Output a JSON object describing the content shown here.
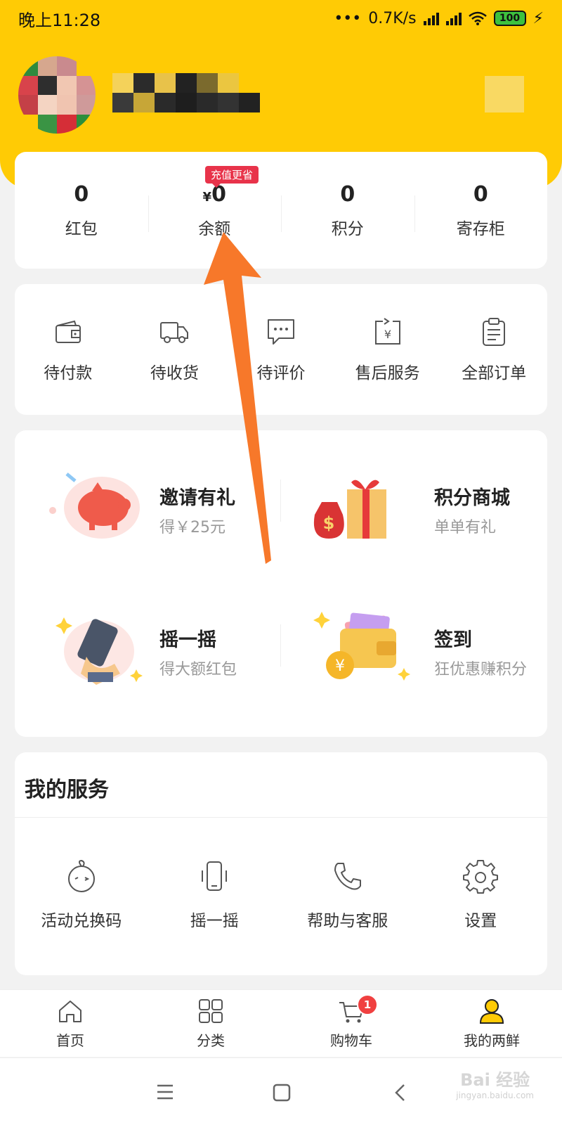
{
  "status_bar": {
    "time": "晚上11:28",
    "net_speed": "0.7K/s",
    "battery": "100"
  },
  "assets": [
    {
      "value": "0",
      "prefix": "",
      "label": "红包",
      "icon": "red-packet"
    },
    {
      "value": "0",
      "prefix": "¥",
      "label": "余额",
      "icon": "balance"
    },
    {
      "value": "0",
      "prefix": "",
      "label": "积分",
      "icon": "points"
    },
    {
      "value": "0",
      "prefix": "",
      "label": "寄存柜",
      "icon": "locker"
    }
  ],
  "balance_badge": "充值更省",
  "orders": [
    {
      "label": "待付款",
      "icon": "wallet-icon"
    },
    {
      "label": "待收货",
      "icon": "truck-icon"
    },
    {
      "label": "待评价",
      "icon": "chat-icon"
    },
    {
      "label": "售后服务",
      "icon": "refund-icon"
    },
    {
      "label": "全部订单",
      "icon": "clipboard-icon"
    }
  ],
  "promos": [
    {
      "title": "邀请有礼",
      "subtitle": "得￥25元",
      "icon": "piggy-bank-icon"
    },
    {
      "title": "积分商城",
      "subtitle": "单单有礼",
      "icon": "gift-box-icon"
    },
    {
      "title": "摇一摇",
      "subtitle": "得大额红包",
      "icon": "phone-shake-icon"
    },
    {
      "title": "签到",
      "subtitle": "狂优惠赚积分",
      "icon": "wallet-coin-icon"
    }
  ],
  "services": {
    "title": "我的服务",
    "items": [
      {
        "label": "活动兑换码",
        "icon": "baby-face-icon"
      },
      {
        "label": "摇一摇",
        "icon": "phone-vibrate-icon"
      },
      {
        "label": "帮助与客服",
        "icon": "phone-handset-icon"
      },
      {
        "label": "设置",
        "icon": "gear-icon"
      }
    ]
  },
  "tabbar": [
    {
      "label": "首页",
      "icon": "home-icon"
    },
    {
      "label": "分类",
      "icon": "grid-icon"
    },
    {
      "label": "购物车",
      "icon": "cart-icon",
      "badge": "1"
    },
    {
      "label": "我的两鲜",
      "icon": "user-icon",
      "active": true
    }
  ],
  "watermark": {
    "text": "Bai 经验",
    "url": "jingyan.baidu.com"
  },
  "colors": {
    "brand_yellow": "#ffcb05",
    "arrow": "#f7782a",
    "badge_red": "#e8334a"
  }
}
